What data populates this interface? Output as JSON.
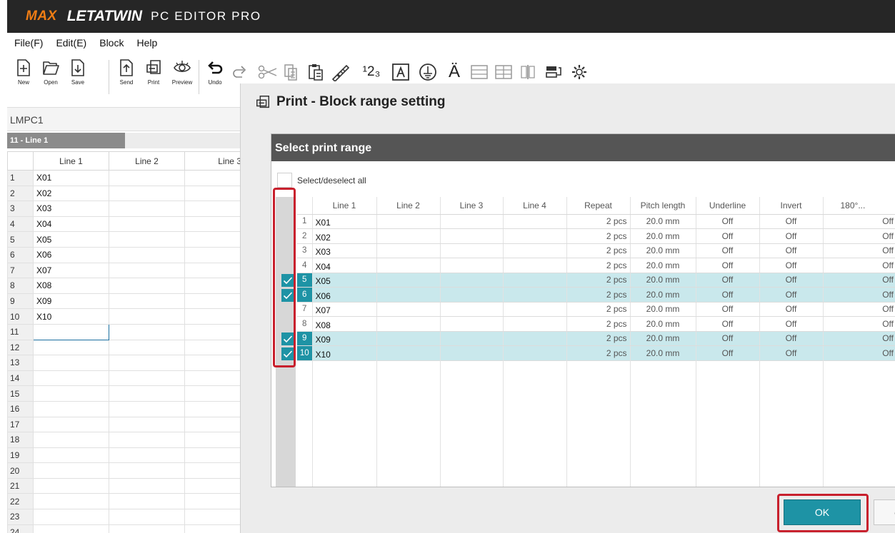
{
  "app": {
    "brand_max": "MAX",
    "brand_letatwin": "LETATWIN",
    "brand_suffix": "PC EDITOR PRO"
  },
  "menu": [
    "File(F)",
    "Edit(E)",
    "Block",
    "Help"
  ],
  "toolbar": {
    "new_label": "New",
    "open_label": "Open",
    "save_label": "Save",
    "send_label": "Send",
    "print_label": "Print",
    "preview_label": "Preview",
    "undo_label": "Undo",
    "numbering_glyph": "¹2₃",
    "umlaut_glyph": "Ä"
  },
  "left": {
    "file_name": "LMPC1",
    "tab_label": "11 - Line 1",
    "columns": [
      "Line 1",
      "Line 2",
      "Line 3"
    ],
    "rows": [
      {
        "n": "1",
        "v": "X01"
      },
      {
        "n": "2",
        "v": "X02"
      },
      {
        "n": "3",
        "v": "X03"
      },
      {
        "n": "4",
        "v": "X04"
      },
      {
        "n": "5",
        "v": "X05"
      },
      {
        "n": "6",
        "v": "X06"
      },
      {
        "n": "7",
        "v": "X07"
      },
      {
        "n": "8",
        "v": "X08"
      },
      {
        "n": "9",
        "v": "X09"
      },
      {
        "n": "10",
        "v": "X10"
      },
      {
        "n": "11",
        "v": ""
      },
      {
        "n": "12",
        "v": ""
      },
      {
        "n": "13",
        "v": ""
      },
      {
        "n": "14",
        "v": ""
      },
      {
        "n": "15",
        "v": ""
      },
      {
        "n": "16",
        "v": ""
      },
      {
        "n": "17",
        "v": ""
      },
      {
        "n": "18",
        "v": ""
      },
      {
        "n": "19",
        "v": ""
      },
      {
        "n": "20",
        "v": ""
      },
      {
        "n": "21",
        "v": ""
      },
      {
        "n": "22",
        "v": ""
      },
      {
        "n": "23",
        "v": ""
      },
      {
        "n": "24",
        "v": ""
      }
    ]
  },
  "dialog": {
    "title": "Print - Block range setting",
    "panel_title": "Select print range",
    "select_all_label": "Select/deselect all",
    "columns": [
      "",
      "Line 1",
      "Line 2",
      "Line 3",
      "Line 4",
      "Repeat",
      "Pitch length",
      "Underline",
      "Invert",
      "180°..."
    ],
    "rows": [
      {
        "n": "1",
        "line1": "X01",
        "repeat": "2 pcs",
        "pitch": "20.0 mm",
        "underline": "Off",
        "invert": "Off",
        "rot": "Off",
        "checked": false
      },
      {
        "n": "2",
        "line1": "X02",
        "repeat": "2 pcs",
        "pitch": "20.0 mm",
        "underline": "Off",
        "invert": "Off",
        "rot": "Off",
        "checked": false
      },
      {
        "n": "3",
        "line1": "X03",
        "repeat": "2 pcs",
        "pitch": "20.0 mm",
        "underline": "Off",
        "invert": "Off",
        "rot": "Off",
        "checked": false
      },
      {
        "n": "4",
        "line1": "X04",
        "repeat": "2 pcs",
        "pitch": "20.0 mm",
        "underline": "Off",
        "invert": "Off",
        "rot": "Off",
        "checked": false
      },
      {
        "n": "5",
        "line1": "X05",
        "repeat": "2 pcs",
        "pitch": "20.0 mm",
        "underline": "Off",
        "invert": "Off",
        "rot": "Off",
        "checked": true
      },
      {
        "n": "6",
        "line1": "X06",
        "repeat": "2 pcs",
        "pitch": "20.0 mm",
        "underline": "Off",
        "invert": "Off",
        "rot": "Off",
        "checked": true
      },
      {
        "n": "7",
        "line1": "X07",
        "repeat": "2 pcs",
        "pitch": "20.0 mm",
        "underline": "Off",
        "invert": "Off",
        "rot": "Off",
        "checked": false
      },
      {
        "n": "8",
        "line1": "X08",
        "repeat": "2 pcs",
        "pitch": "20.0 mm",
        "underline": "Off",
        "invert": "Off",
        "rot": "Off",
        "checked": false
      },
      {
        "n": "9",
        "line1": "X09",
        "repeat": "2 pcs",
        "pitch": "20.0 mm",
        "underline": "Off",
        "invert": "Off",
        "rot": "Off",
        "checked": true
      },
      {
        "n": "10",
        "line1": "X10",
        "repeat": "2 pcs",
        "pitch": "20.0 mm",
        "underline": "Off",
        "invert": "Off",
        "rot": "Off",
        "checked": true
      }
    ],
    "ok_label": "OK",
    "cancel_label": "C"
  },
  "colors": {
    "accent": "#1e93a5",
    "highlight_row": "#c9e8ec",
    "annotation_red": "#c8202d",
    "brand_orange": "#f07d14"
  }
}
